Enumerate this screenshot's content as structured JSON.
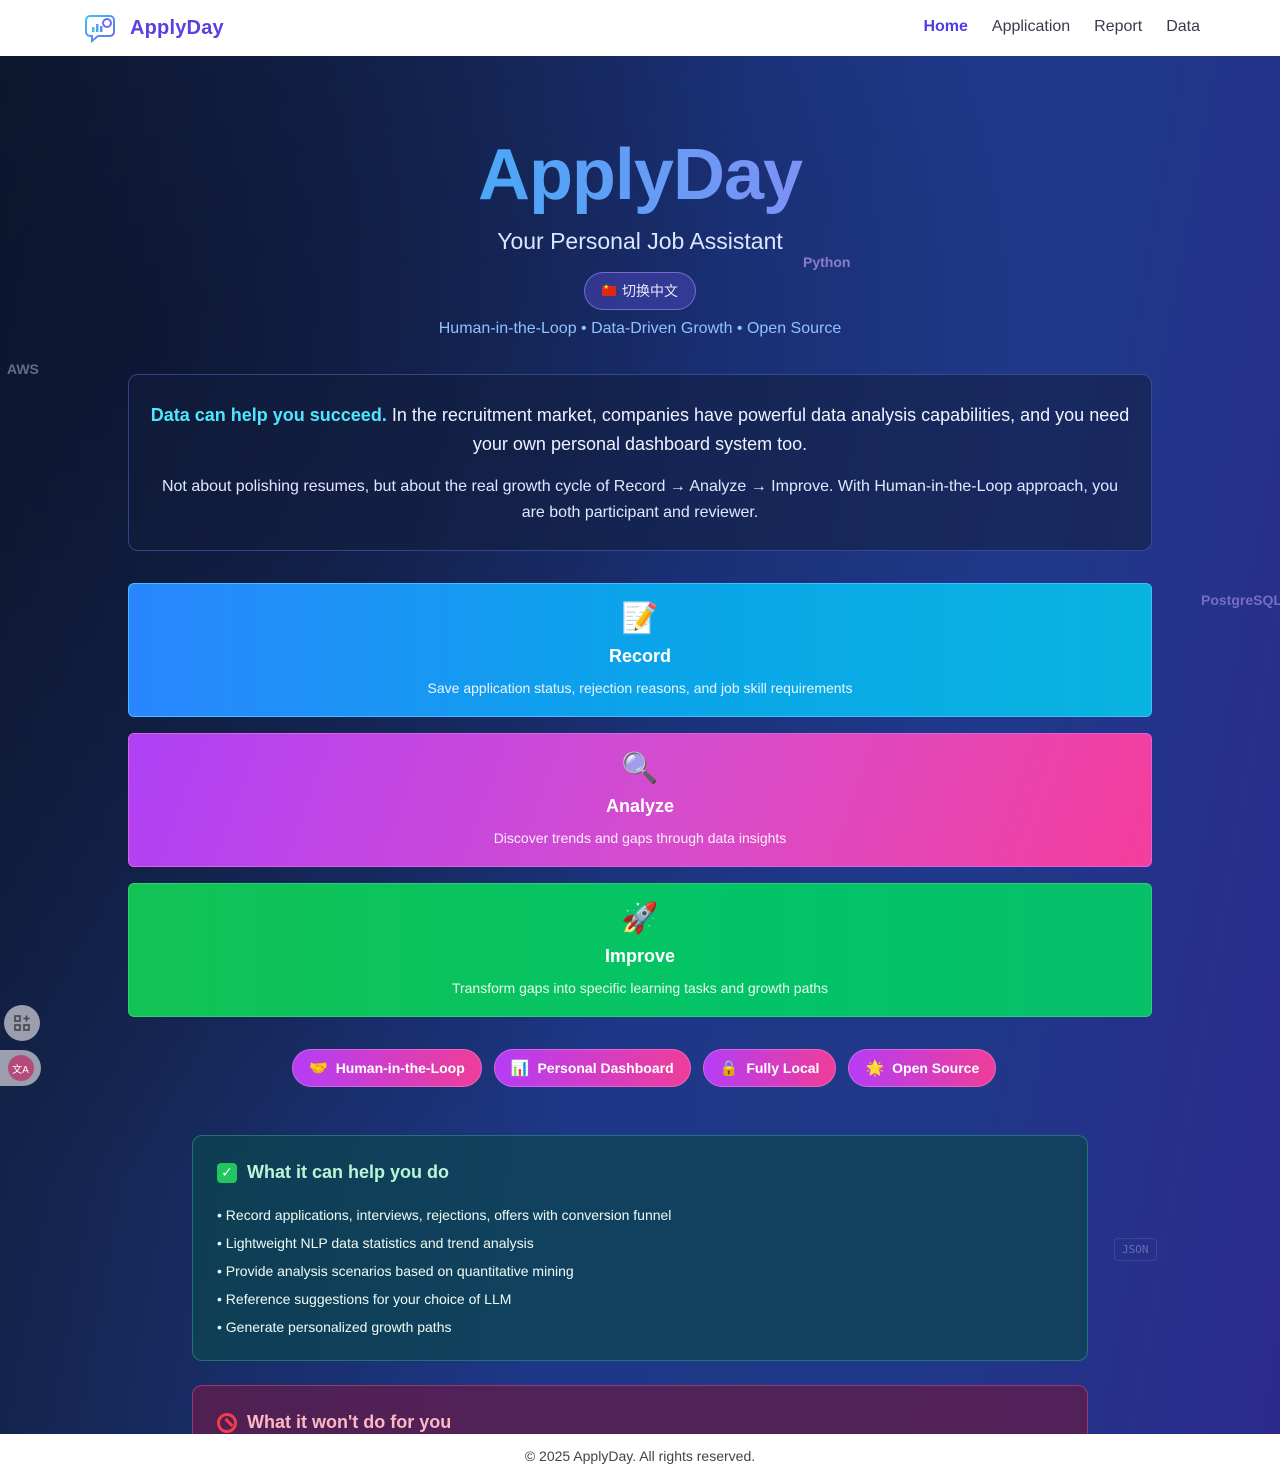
{
  "nav": {
    "brand": "ApplyDay",
    "links": [
      "Home",
      "Application",
      "Report",
      "Data"
    ],
    "active": "Home"
  },
  "hero": {
    "title": "ApplyDay",
    "subtitle": "Your Personal Job Assistant",
    "language_button": "切换中文",
    "tagline": "Human-in-the-Loop • Data-Driven Growth • Open Source",
    "floating_tags": {
      "python": "Python",
      "aws": "AWS",
      "postgres": "PostgreSQL",
      "json": "JSON"
    }
  },
  "intro": {
    "highlight": "Data can help you succeed.",
    "text1": " In the recruitment market, companies have powerful data analysis capabilities, and you need your own personal dashboard system too.",
    "text2": "Not about polishing resumes, but about the real growth cycle of Record → Analyze → Improve. With Human-in-the-Loop approach, you are both participant and reviewer."
  },
  "steps": [
    {
      "icon": "📝",
      "title": "Record",
      "desc": "Save application status, rejection reasons, and job skill requirements"
    },
    {
      "icon": "🔍",
      "title": "Analyze",
      "desc": "Discover trends and gaps through data insights"
    },
    {
      "icon": "🚀",
      "title": "Improve",
      "desc": "Transform gaps into specific learning tasks and growth paths"
    }
  ],
  "pills": [
    {
      "icon": "🤝",
      "label": "Human-in-the-Loop"
    },
    {
      "icon": "📊",
      "label": "Personal Dashboard"
    },
    {
      "icon": "🔒",
      "label": "Fully Local"
    },
    {
      "icon": "🌟",
      "label": "Open Source"
    }
  ],
  "can_do": {
    "title": "What it can help you do",
    "items": [
      "• Record applications, interviews, rejections, offers with conversion funnel",
      "• Lightweight NLP data statistics and trend analysis",
      "• Provide analysis scenarios based on quantitative mining",
      "• Reference suggestions for your choice of LLM",
      "• Generate personalized growth paths"
    ]
  },
  "wont_do": {
    "title": "What it won't do for you"
  },
  "footer": {
    "text": "© 2025 ApplyDay. All rights reserved."
  },
  "colors": {
    "brand": "#5b3fe0",
    "highlight": "#4ee6ff",
    "record": "#0aa4ea",
    "analyze": "#d74ccc",
    "improve": "#02c467"
  }
}
